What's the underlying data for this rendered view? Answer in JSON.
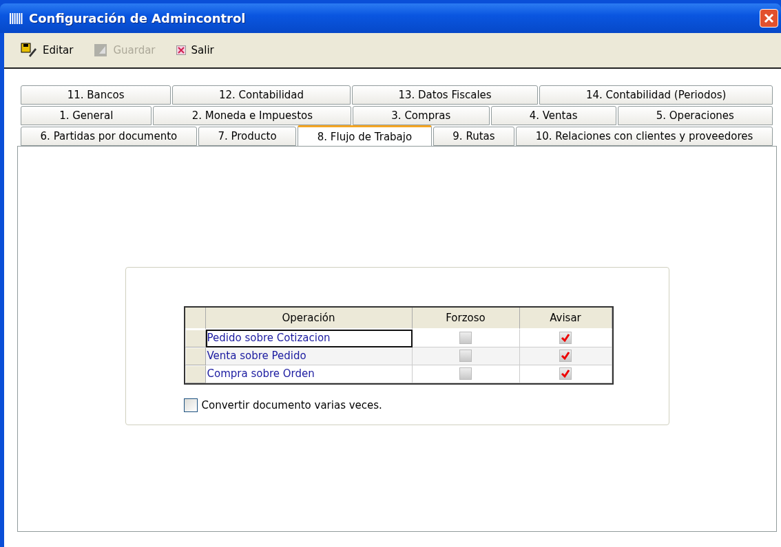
{
  "window": {
    "title": "Configuración de Admincontrol"
  },
  "toolbar": [
    {
      "kind": "edit",
      "label": "Editar",
      "disabled": false
    },
    {
      "kind": "save",
      "label": "Guardar",
      "disabled": true
    },
    {
      "kind": "exit",
      "label": "Salir",
      "disabled": false
    }
  ],
  "tab_rows": [
    [
      {
        "label": "11. Bancos",
        "selected": false
      },
      {
        "label": "12. Contabilidad",
        "selected": false
      },
      {
        "label": "13. Datos Fiscales",
        "selected": false
      },
      {
        "label": "14. Contabilidad (Periodos)",
        "selected": false
      }
    ],
    [
      {
        "label": "1. General",
        "selected": false
      },
      {
        "label": "2. Moneda e Impuestos",
        "selected": false
      },
      {
        "label": "3. Compras",
        "selected": false
      },
      {
        "label": "4. Ventas",
        "selected": false
      },
      {
        "label": "5. Operaciones",
        "selected": false
      }
    ],
    [
      {
        "label": "6. Partidas por documento",
        "selected": false
      },
      {
        "label": "7. Producto",
        "selected": false
      },
      {
        "label": "8. Flujo de Trabajo",
        "selected": true
      },
      {
        "label": "9. Rutas",
        "selected": false
      },
      {
        "label": "10. Relaciones con clientes y proveedores",
        "selected": false
      }
    ]
  ],
  "table": {
    "columns": [
      "Operación",
      "Forzoso",
      "Avisar"
    ],
    "rows": [
      {
        "operation": "Pedido sobre Cotizacion",
        "forzoso": false,
        "avisar": true,
        "selected": true
      },
      {
        "operation": "Venta sobre Pedido",
        "forzoso": false,
        "avisar": true,
        "selected": false
      },
      {
        "operation": "Compra sobre Orden",
        "forzoso": false,
        "avisar": true,
        "selected": false
      }
    ]
  },
  "option": {
    "label": "Convertir documento varias veces.",
    "checked": false
  }
}
